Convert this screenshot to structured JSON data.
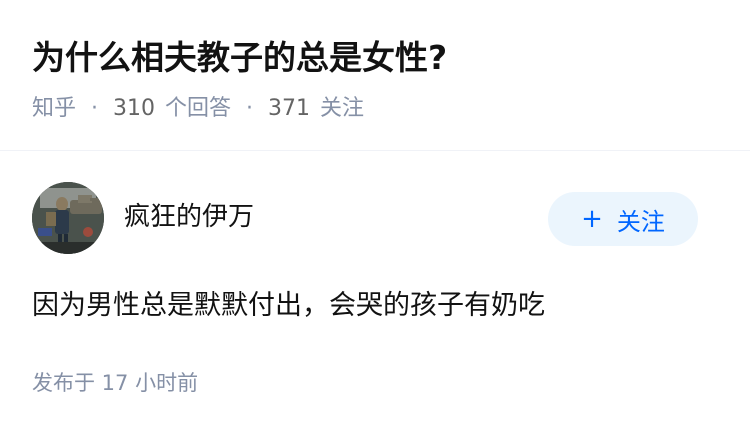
{
  "question": {
    "title": "为什么相夫教子的总是女性?",
    "source": "知乎",
    "answer_count": "310",
    "answer_label": "个回答",
    "follower_count": "371",
    "follower_label": "关注"
  },
  "answer": {
    "author_name": "疯狂的伊万",
    "follow_plus": "+",
    "follow_label": "关注",
    "content": "因为男性总是默默付出，会哭的孩子有奶吃",
    "published": "发布于  17 小时前"
  },
  "colors": {
    "title": "#121212",
    "meta": "#8590a6",
    "follow_bg": "#ebf5fd",
    "follow_text": "#0066ff"
  },
  "icons": [
    "avatar-image",
    "plus-icon"
  ]
}
